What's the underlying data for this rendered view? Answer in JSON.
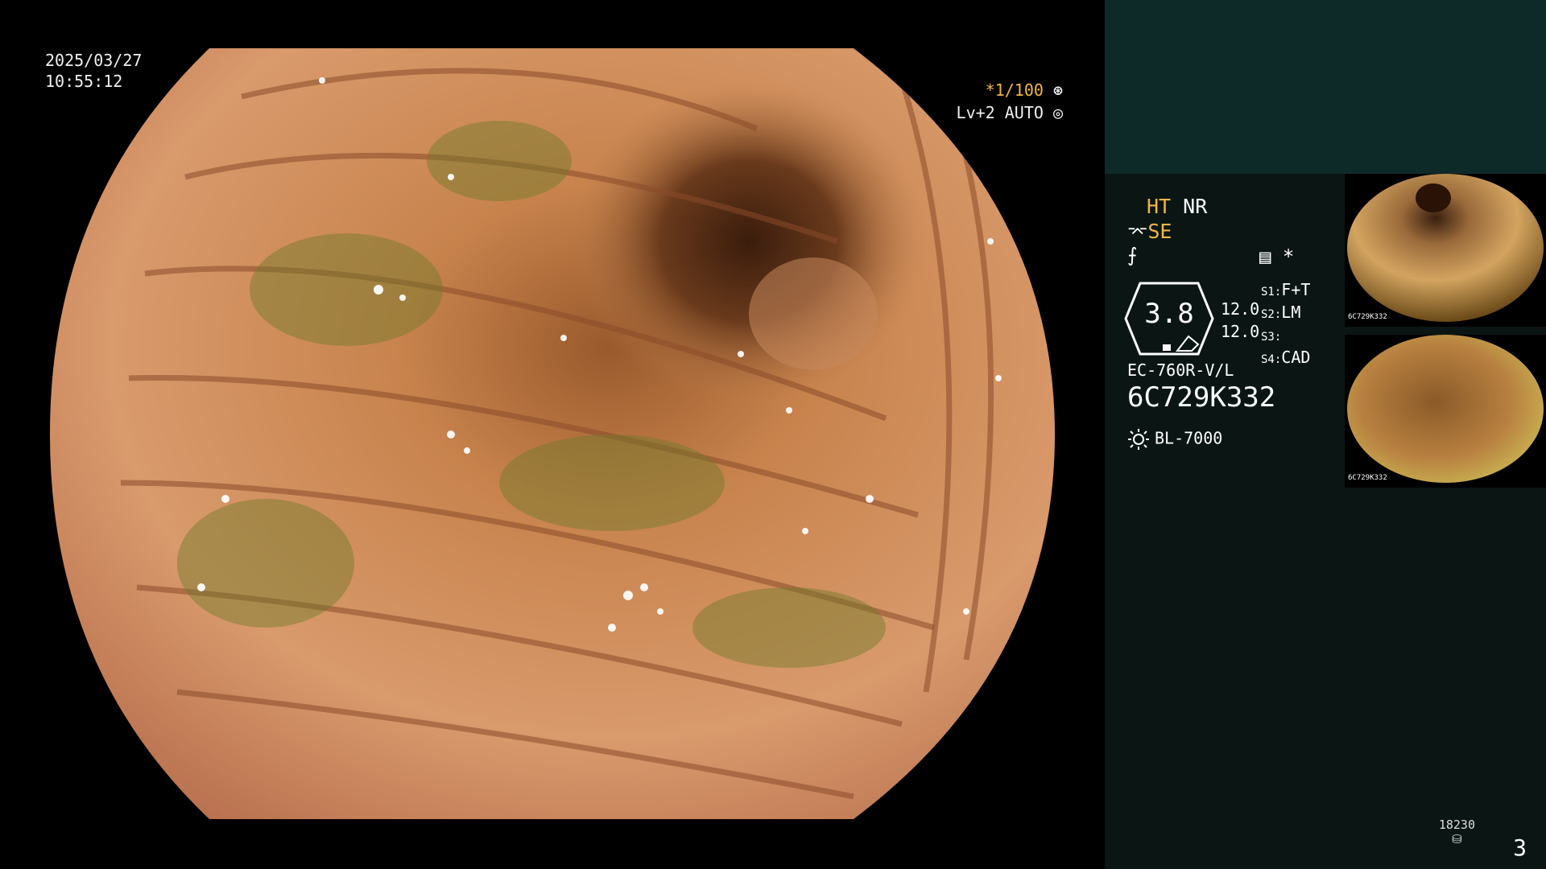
{
  "osd": {
    "date": "2025/03/27",
    "time": "10:55:12",
    "shutter": "*1/100",
    "level": "Lv+2 AUTO"
  },
  "panel": {
    "ht": "HT",
    "nr": "NR",
    "se": "SE",
    "octagon_value": "3.8",
    "zoom_top": "12.0",
    "zoom_bottom": "12.0",
    "s1_key": "S1",
    "s1_val": "F+T",
    "s2_key": "S2",
    "s2_val": "LM",
    "s3_key": "S3",
    "s3_val": "",
    "s4_key": "S4",
    "s4_val": "CAD",
    "scope_model": "EC-760R-V/L",
    "serial": "6C729K332",
    "light_source": "BL-7000",
    "counter": "18230",
    "page": "3"
  },
  "thumbnails": [
    {
      "serial": "6C729K332"
    },
    {
      "serial": "6C729K332"
    }
  ],
  "colors": {
    "accent_yellow": "#f2b64a",
    "panel_top": "#0e2a28",
    "panel_bottom": "#0b1614"
  }
}
